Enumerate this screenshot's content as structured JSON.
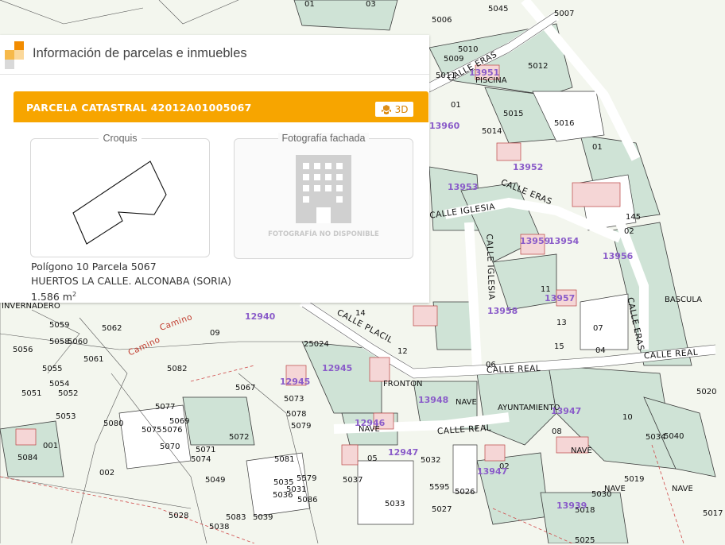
{
  "panel": {
    "title": "Información de parcelas e inmuebles",
    "parcel_title": "PARCELA CATASTRAL 42012A01005067",
    "button_3d": "3D",
    "sketch_label": "Croquis",
    "photo_label": "Fotografía fachada",
    "photo_unavailable": "FOTOGRAFÍA NO DISPONIBLE",
    "polygon_line": "Polígono 10 Parcela 5067",
    "location_line": "HUERTOS LA CALLE. ALCONABA (SORIA)",
    "area_value": "1.586 m",
    "area_unit_sup": "2",
    "accent_color": "#f7a500"
  },
  "map": {
    "streets": [
      "CALLE ERAS",
      "CALLE ERAS",
      "CALLE IGLESIA",
      "CALLE IGLESIA",
      "CALLE PLACIL",
      "CALLE REAL",
      "CALLE REAL",
      "CALLE REAL",
      "CALLE ERAS",
      "Camino",
      "Camino"
    ],
    "purple_labels": [
      "13951",
      "13952",
      "13953",
      "13959",
      "13954",
      "13956",
      "13957",
      "13958",
      "12940",
      "12945",
      "12945",
      "13948",
      "12946",
      "12947",
      "13947",
      "13947",
      "13939",
      "13960"
    ],
    "labels": [
      "01",
      "03",
      "5006",
      "5045",
      "5007",
      "5011",
      "5010",
      "5009",
      "5012",
      "PISCINA",
      "01",
      "5015",
      "5016",
      "5014",
      "01",
      "145",
      "02",
      "BASCULA",
      "INVERNADERO",
      "5059",
      "5058",
      "5062",
      "5060",
      "5061",
      "5056",
      "5055",
      "5054",
      "5051",
      "5052",
      "5053",
      "5082",
      "5067",
      "5077",
      "5069",
      "5074",
      "5072",
      "5076",
      "5075",
      "5070",
      "5071",
      "5073",
      "5078",
      "5079",
      "5080",
      "5084",
      "001",
      "002",
      "5049",
      "5081",
      "5035",
      "5036",
      "5037",
      "5033",
      "5030",
      "5026",
      "5027",
      "5028",
      "5083",
      "5039",
      "5038",
      "5040",
      "5019",
      "5020",
      "5017",
      "5018",
      "5025",
      "25024",
      "NAVE",
      "NAVE",
      "NAVE",
      "NAVE",
      "NAVE",
      "FRONTON",
      "AYUNTAMIENTO",
      "08",
      "10",
      "02",
      "06",
      "07",
      "04",
      "14",
      "15",
      "13",
      "11",
      "12",
      "09",
      "05",
      "5595",
      "5579",
      "5086",
      "5031",
      "5034",
      "5032",
      "5019",
      "01"
    ]
  }
}
